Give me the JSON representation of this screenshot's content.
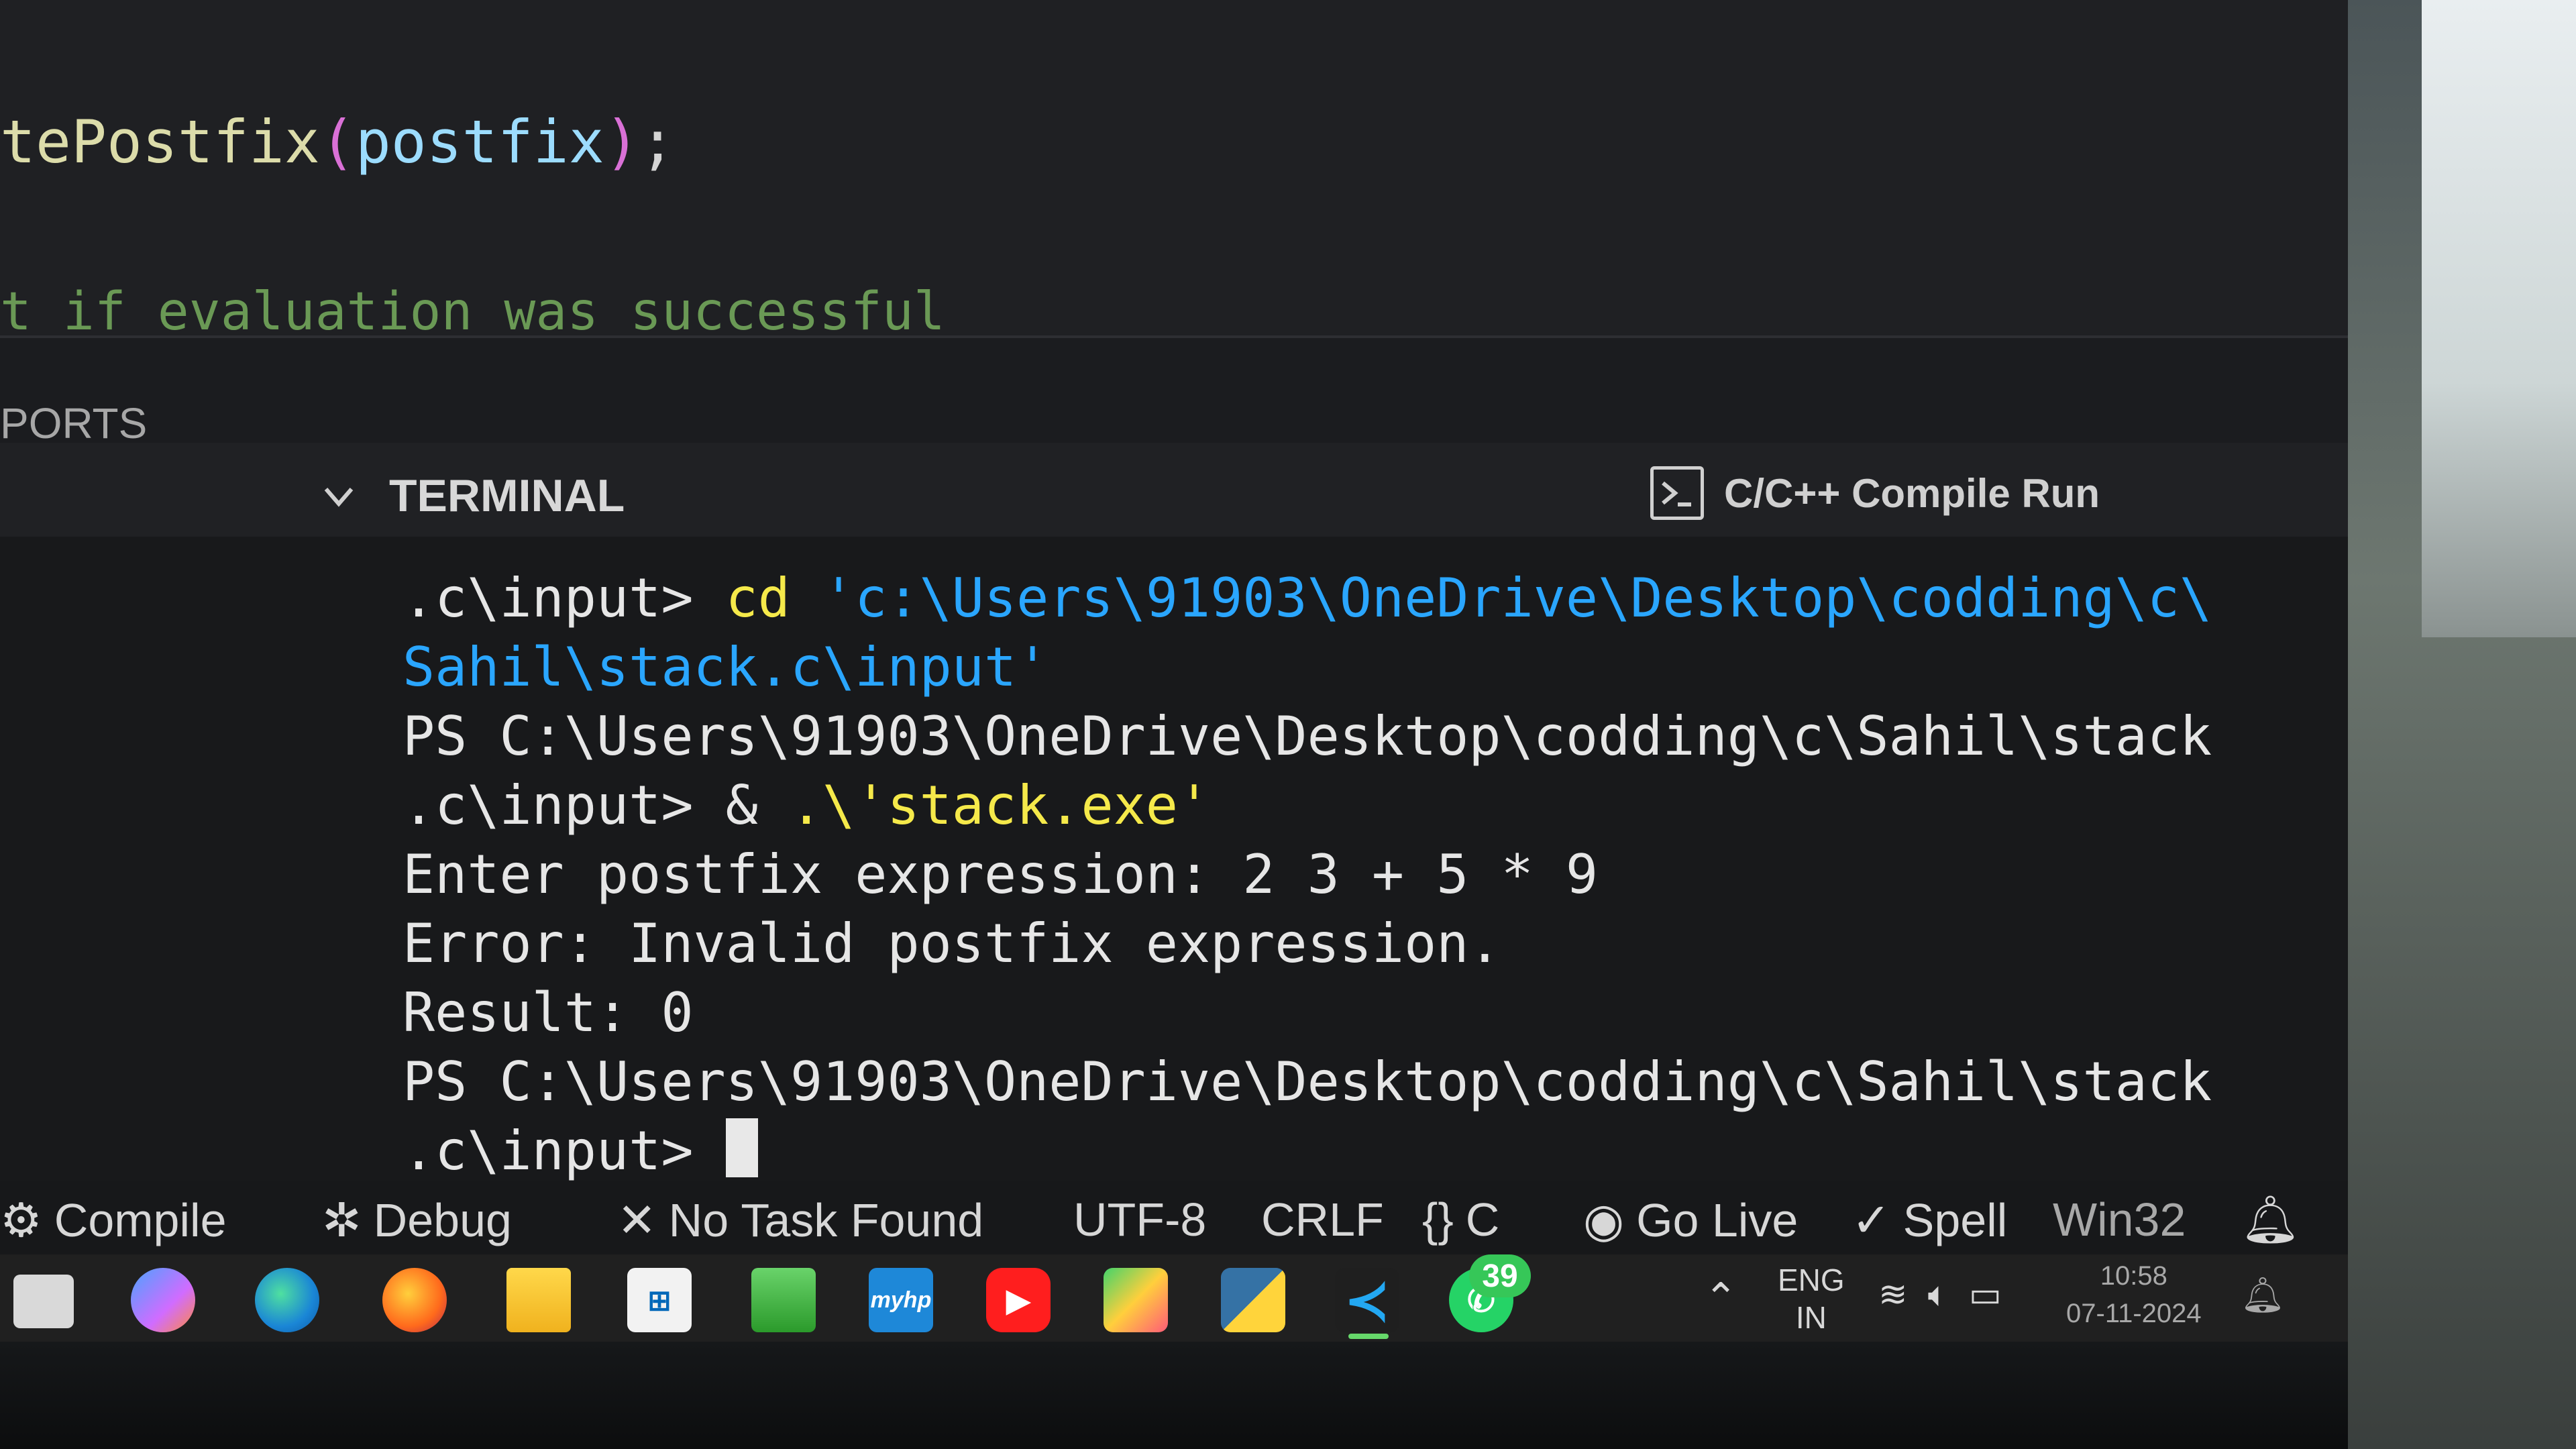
{
  "editor": {
    "code_line_1": {
      "fn": "tePostfix",
      "open": "(",
      "arg": "postfix",
      "close": ")",
      "end": ";"
    },
    "code_line_2": "t if evaluation was successful"
  },
  "panel": {
    "ports_tab": "PORTS",
    "terminal_title": "TERMINAL",
    "compile_run_label": "C/C++ Compile Run"
  },
  "terminal": {
    "lines": [
      {
        "prompt": ".c\\input> ",
        "cmd": "cd ",
        "str": "'c:\\Users\\91903\\OneDrive\\Desktop\\codding\\c\\"
      },
      {
        "str": "Sahil\\stack.c\\input'"
      },
      {
        "text": "PS C:\\Users\\91903\\OneDrive\\Desktop\\codding\\c\\Sahil\\stack"
      },
      {
        "prompt": ".c\\input> ",
        "amp": "& ",
        "cmd": ".\\'stack.exe'"
      },
      {
        "text": "Enter postfix expression: 2 3 + 5 * 9"
      },
      {
        "text": "Error: Invalid postfix expression."
      },
      {
        "text": "Result: 0"
      },
      {
        "text": "PS C:\\Users\\91903\\OneDrive\\Desktop\\codding\\c\\Sahil\\stack"
      },
      {
        "prompt": ".c\\input> "
      }
    ]
  },
  "status_bar": {
    "compile": "Compile",
    "debug": "Debug",
    "no_task": "No Task Found",
    "encoding": "UTF-8",
    "eol": "CRLF",
    "language_braces": "{}",
    "language": "C",
    "go_live": "Go Live",
    "spell": "Spell",
    "platform": "Win32"
  },
  "taskbar": {
    "whatsapp_badge": "39",
    "lang_line1": "ENG",
    "lang_line2": "IN",
    "time": "10:58",
    "date": "07-11-2024",
    "myhp_label": "myhp"
  },
  "colors": {
    "accent_vscode": "#23a8f2",
    "terminal_string": "#2aa6ff",
    "terminal_cmd": "#f5e94a",
    "comment": "#6a9955"
  }
}
